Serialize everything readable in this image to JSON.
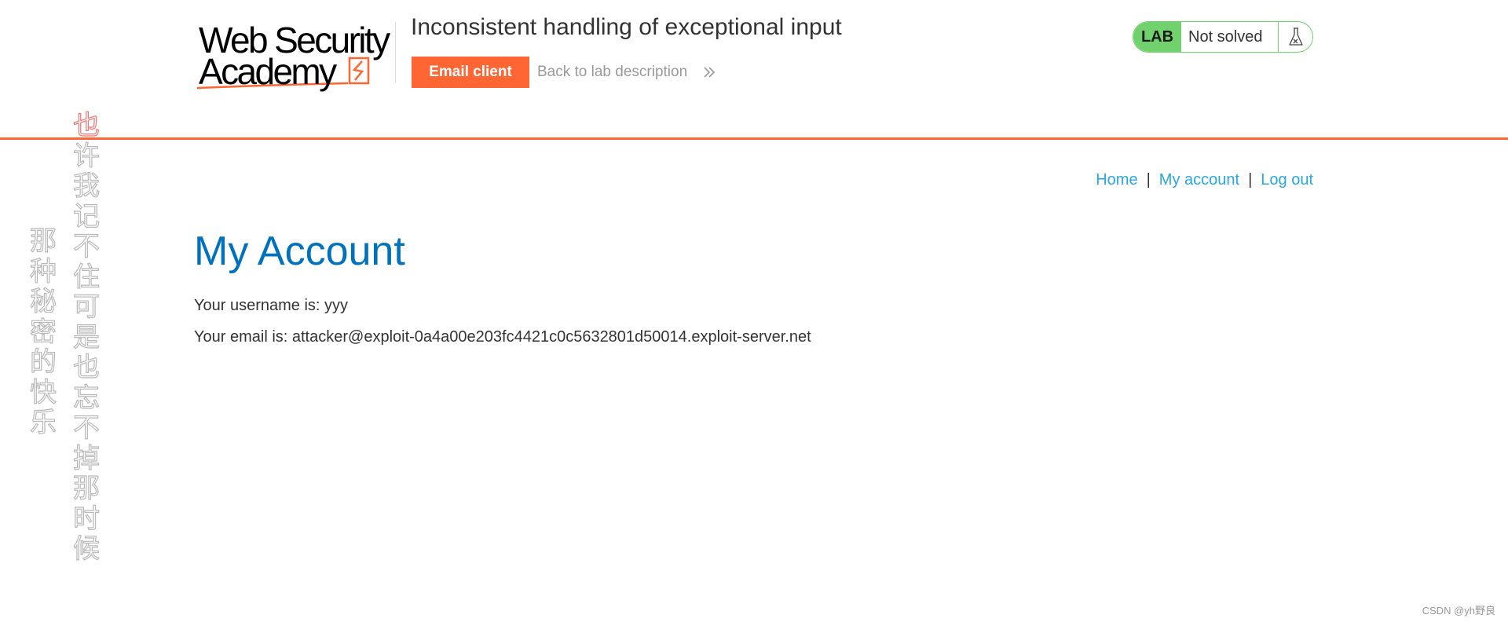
{
  "header": {
    "logo": {
      "line1": "Web Security",
      "line2": "Academy"
    },
    "lab_title": "Inconsistent handling of exceptional input",
    "email_client_label": "Email client",
    "back_link_label": "Back to lab description",
    "lab_badge": "LAB",
    "lab_status": "Not solved",
    "colors": {
      "accent": "#ff6633",
      "status_green": "#70d16d"
    }
  },
  "side_poem": {
    "column1": [
      "那",
      "种",
      "秘",
      "密",
      "的",
      "快",
      "乐"
    ],
    "column2": [
      "也",
      "许",
      "我",
      "记",
      "不",
      "住",
      "可",
      "是",
      "也",
      "忘",
      "不",
      "掉",
      "那",
      "时",
      "候"
    ]
  },
  "nav": {
    "home": "Home",
    "separator": "|",
    "my_account": "My account",
    "log_out": "Log out",
    "link_color": "#29a8e0"
  },
  "main": {
    "title": "My Account",
    "username_line": "Your username is: yyy",
    "email_line": "Your email is: attacker@exploit-0a4a00e203fc4421c0c5632801d50014.exploit-server.net",
    "title_color": "#0071bc"
  },
  "watermark": "CSDN @yh野良"
}
